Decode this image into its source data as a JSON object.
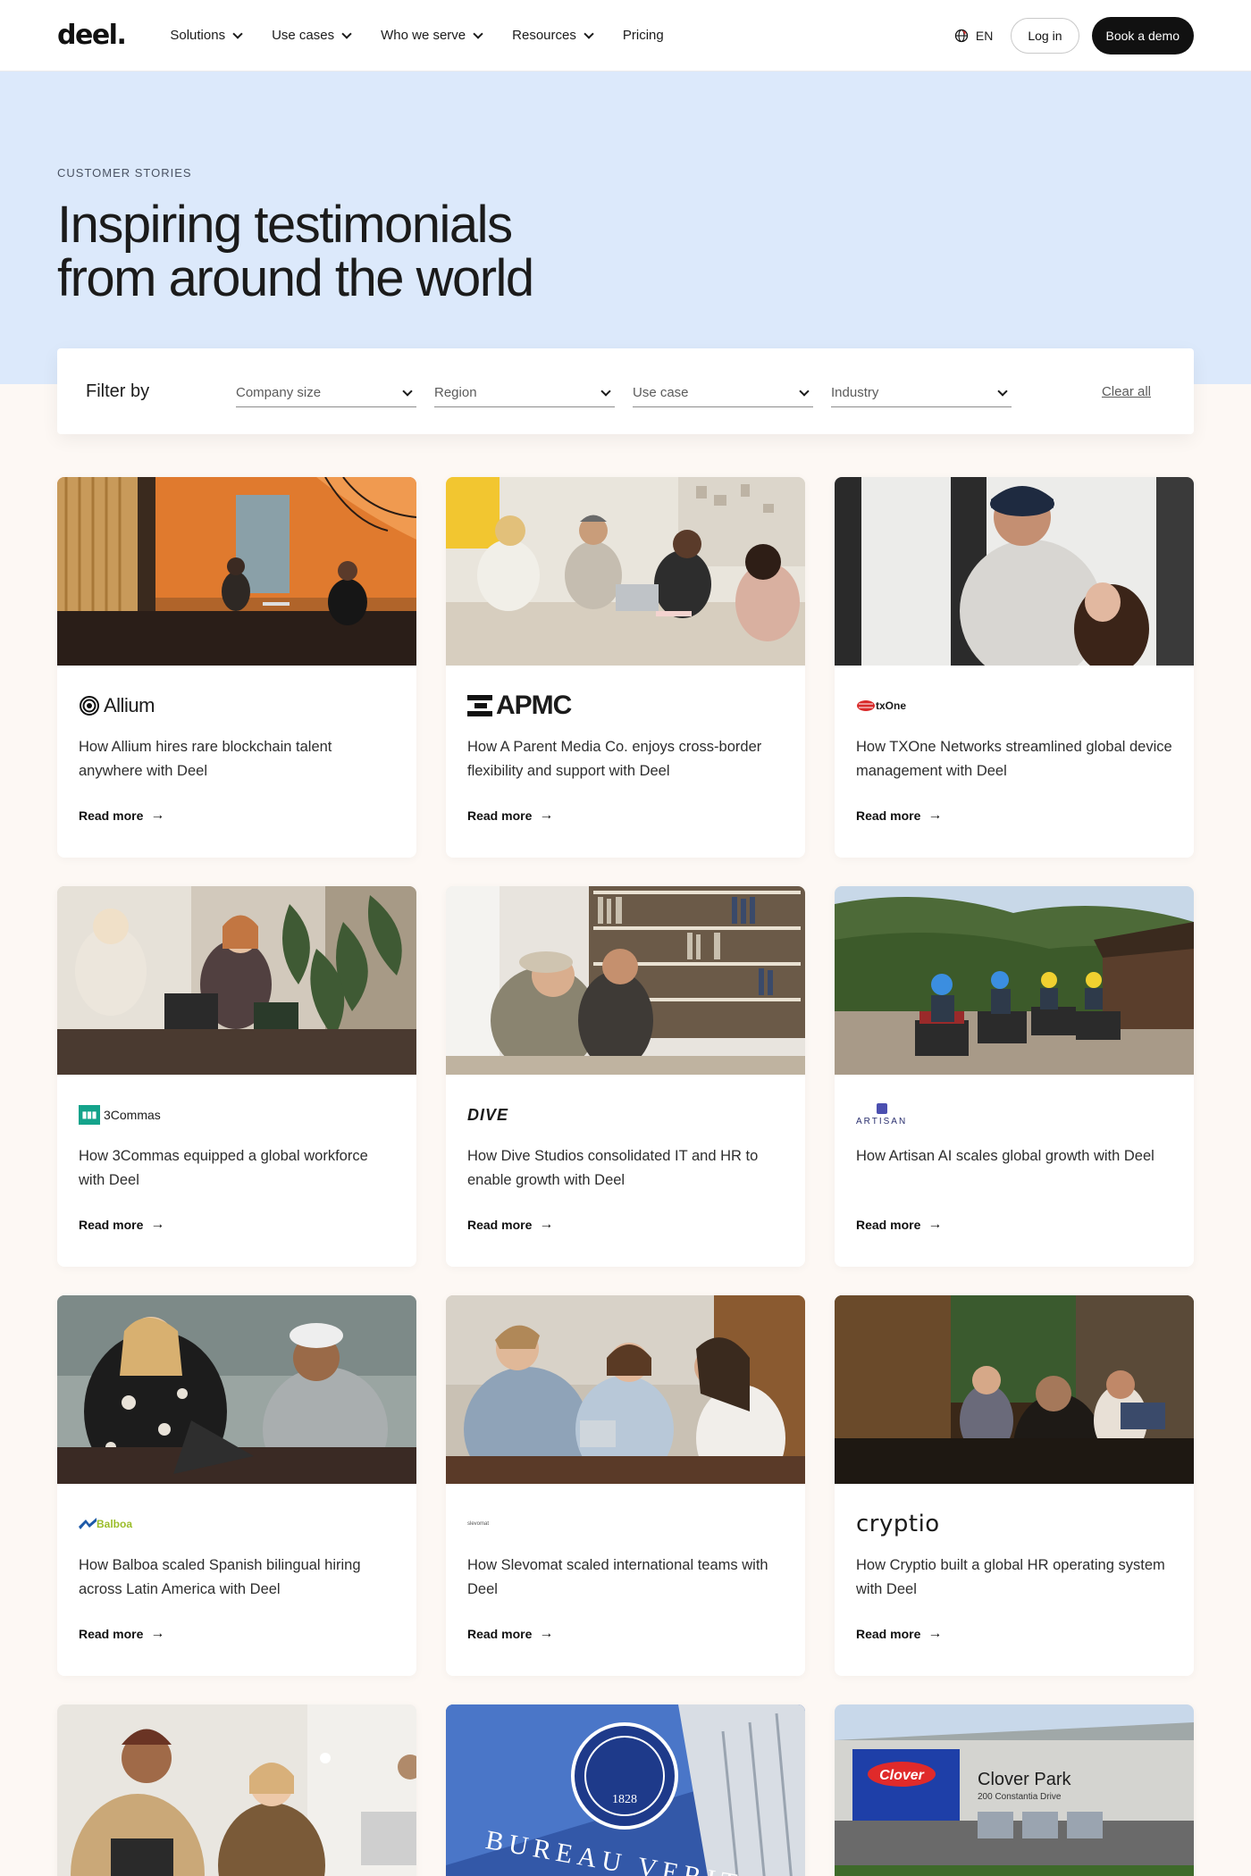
{
  "nav": {
    "logo": "deel.",
    "items": [
      {
        "label": "Solutions",
        "has_dropdown": true
      },
      {
        "label": "Use cases",
        "has_dropdown": true
      },
      {
        "label": "Who we serve",
        "has_dropdown": true
      },
      {
        "label": "Resources",
        "has_dropdown": true
      },
      {
        "label": "Pricing",
        "has_dropdown": false
      }
    ],
    "language": "EN",
    "login_label": "Log in",
    "demo_label": "Book a demo"
  },
  "hero": {
    "eyebrow": "CUSTOMER STORIES",
    "title": "Inspiring testimonials from around the world"
  },
  "filter": {
    "label": "Filter by",
    "selects": [
      {
        "placeholder": "Company size"
      },
      {
        "placeholder": "Region"
      },
      {
        "placeholder": "Use case"
      },
      {
        "placeholder": "Industry"
      }
    ],
    "clear_label": "Clear all"
  },
  "cards": [
    {
      "brand": "Allium",
      "description": "How Allium hires rare blockchain talent anywhere with Deel",
      "cta": "Read more"
    },
    {
      "brand": "APMC",
      "description": "How A Parent Media Co. enjoys cross-border flexibility and support with Deel",
      "cta": "Read more"
    },
    {
      "brand": "txOne",
      "description": "How TXOne Networks streamlined global device management with Deel",
      "cta": "Read more"
    },
    {
      "brand": "3Commas",
      "description": "How 3Commas equipped a global workforce with Deel",
      "cta": "Read more"
    },
    {
      "brand": "DIVE",
      "description": "How Dive Studios consolidated IT and HR to enable growth with Deel",
      "cta": "Read more"
    },
    {
      "brand": "ARTISAN",
      "description": "How Artisan AI scales global growth with Deel",
      "cta": "Read more"
    },
    {
      "brand": "Balboa",
      "description": "How Balboa scaled Spanish bilingual hiring across Latin America with Deel",
      "cta": "Read more"
    },
    {
      "brand": "slevomat",
      "description": "How Slevomat scaled international teams with Deel",
      "cta": "Read more"
    },
    {
      "brand": "cryptio",
      "description": "How Cryptio built a global HR operating system with Deel",
      "cta": "Read more"
    }
  ],
  "partial_cards": [
    {
      "photo_text": ""
    },
    {
      "photo_text": "BUREAU VERITAS"
    },
    {
      "photo_text": "Clover Park",
      "photo_subtext": "200 Constantia Drive",
      "sign_brand": "Clover"
    }
  ],
  "colors": {
    "hero_bg": "#dce9fb",
    "page_bg": "#fdf8f4",
    "demo_button": "#111111"
  }
}
